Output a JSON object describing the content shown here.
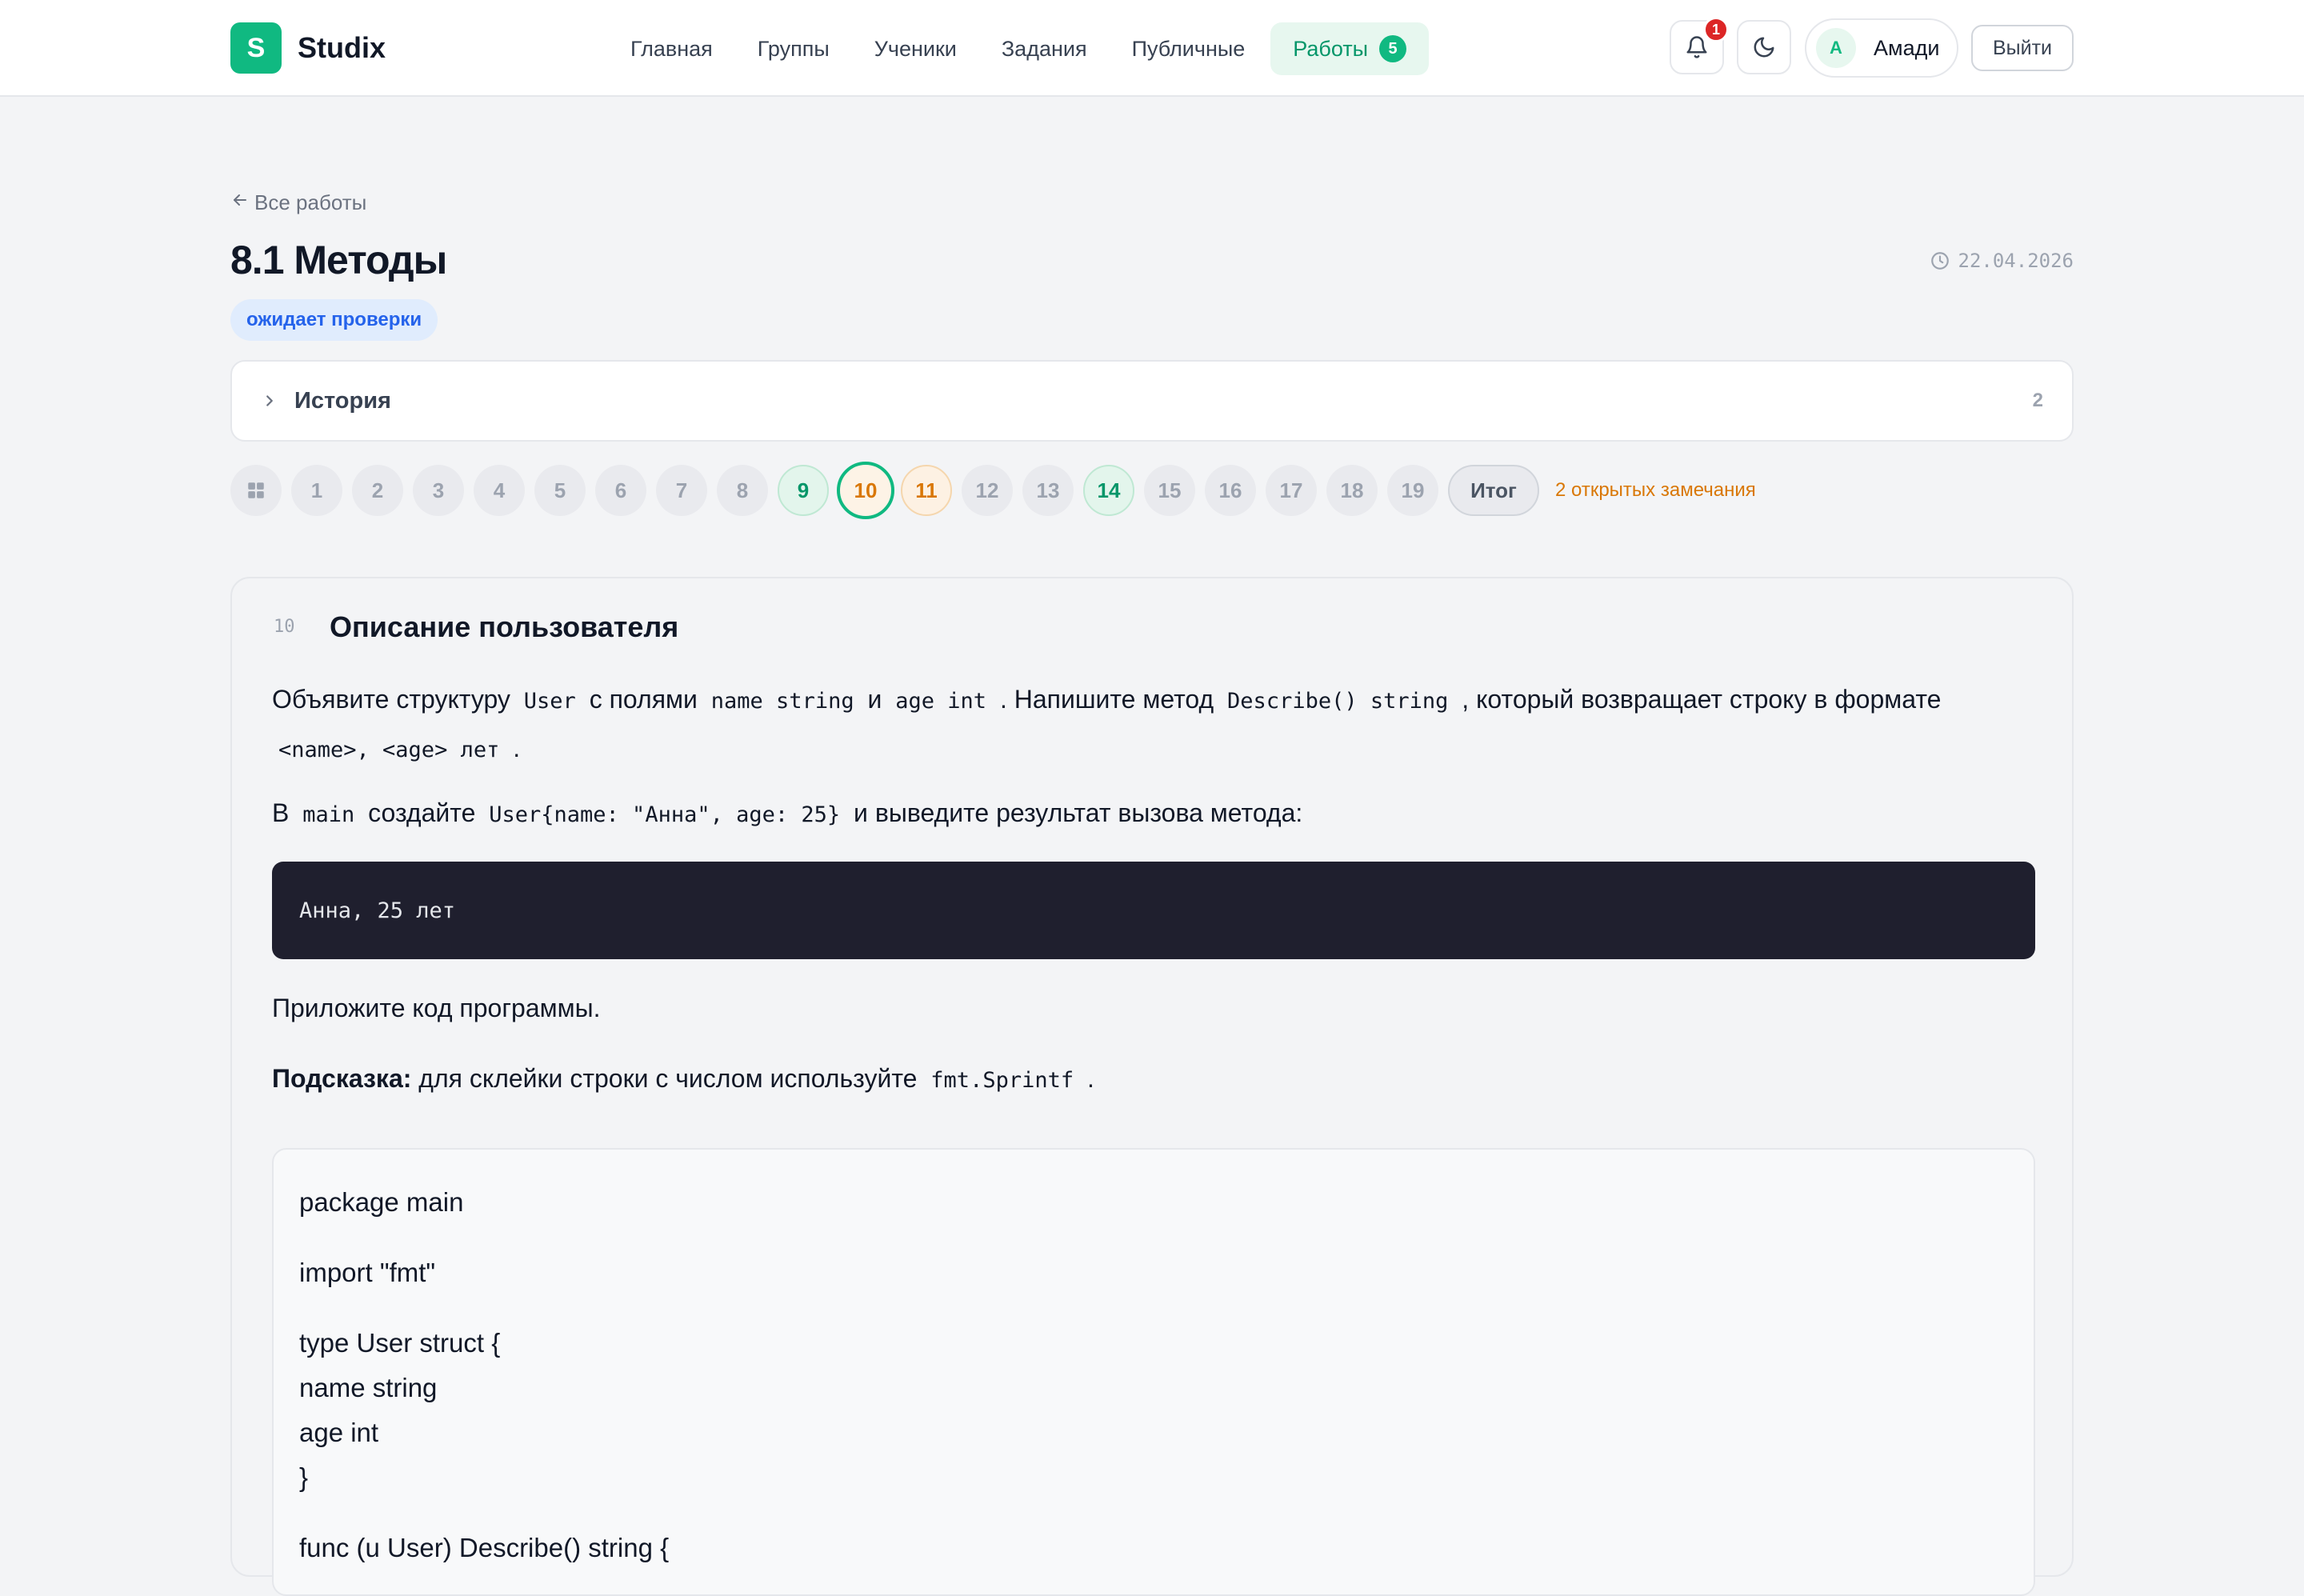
{
  "header": {
    "logo_letter": "S",
    "logo_text": "Studix",
    "nav": [
      {
        "label": "Главная"
      },
      {
        "label": "Группы"
      },
      {
        "label": "Ученики"
      },
      {
        "label": "Задания"
      },
      {
        "label": "Публичные"
      },
      {
        "label": "Работы",
        "badge": "5"
      }
    ],
    "notifications_count": "1",
    "user_initial": "A",
    "user_name": "Амади",
    "logout_label": "Выйти"
  },
  "page": {
    "back_label": "Все работы",
    "title": "8.1 Методы",
    "date": "22.04.2026",
    "status": "ожидает проверки",
    "history_label": "История",
    "history_count": "2"
  },
  "steps": {
    "items": [
      "1",
      "2",
      "3",
      "4",
      "5",
      "6",
      "7",
      "8",
      "9",
      "10",
      "11",
      "12",
      "13",
      "14",
      "15",
      "16",
      "17",
      "18",
      "19"
    ],
    "states": {
      "9": "done",
      "10": "current",
      "11": "warn",
      "14": "done"
    },
    "total_label": "Итог",
    "open_notes": "2 открытых замечания"
  },
  "task": {
    "number": "10",
    "title": "Описание пользователя",
    "p1": {
      "t1": "Объявите структуру",
      "c1": "User",
      "t2": "с полями",
      "c2": "name string",
      "t3": "и",
      "c3": "age int",
      "t4": ". Напишите метод",
      "c4": "Describe() string",
      "t5": ", который возвращает строку в формате",
      "c5": "<name>, <age> лет",
      "t6": "."
    },
    "p2": {
      "t1": "В",
      "c1": "main",
      "t2": "создайте",
      "c2": "User{name: \"Анна\", age: 25}",
      "t3": "и выведите результат вызова метода:"
    },
    "output": "Анна, 25 лет",
    "p3": "Приложите код программы.",
    "hint": {
      "label": "Подсказка:",
      "text": "для склейки строки с числом используйте",
      "code": "fmt.Sprintf",
      "end": "."
    },
    "code_lines": {
      "l1": "package main",
      "l2": "import \"fmt\"",
      "l3": "type User struct {",
      "l4": "name string",
      "l5": "age int",
      "l6": "}",
      "l7": "func (u User) Describe() string {"
    }
  },
  "colors": {
    "accent": "#10b981",
    "status_blue": "#2563eb",
    "warning": "#d97706",
    "danger": "#dc2626"
  }
}
